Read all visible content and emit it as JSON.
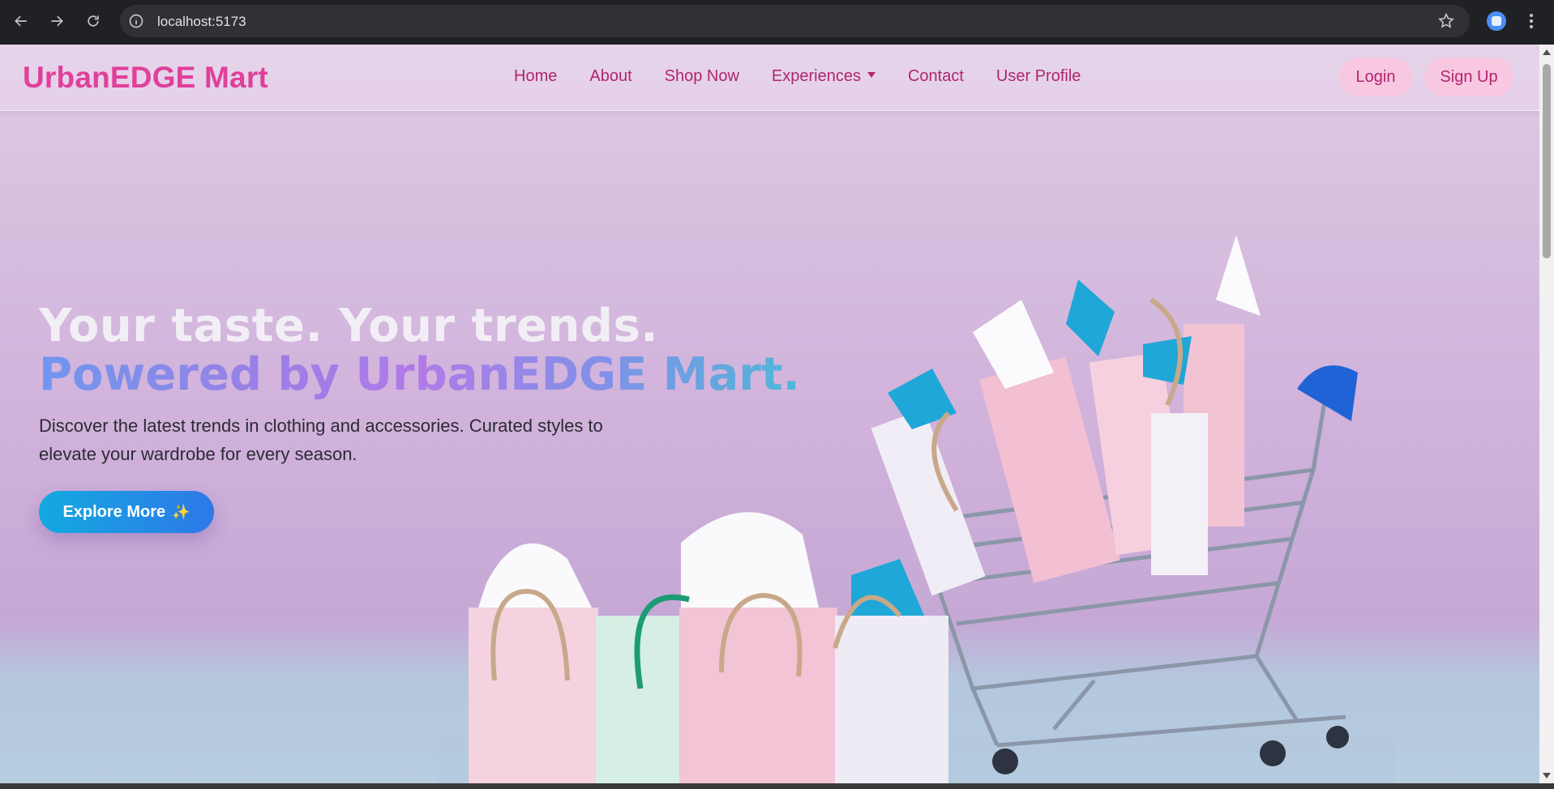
{
  "browser": {
    "url": "localhost:5173",
    "icons": [
      "back-arrow-icon",
      "forward-arrow-icon",
      "reload-icon",
      "site-info-icon",
      "bookmark-star-icon",
      "extension-icon",
      "browser-menu-icon"
    ]
  },
  "navbar": {
    "brand": "UrbanEDGE Mart",
    "links": [
      "Home",
      "About",
      "Shop Now",
      "Experiences",
      "Contact",
      "User Profile"
    ],
    "login": "Login",
    "signup": "Sign Up"
  },
  "hero": {
    "line1": "Your taste. Your trends.",
    "line2": "Powered by UrbanEDGE Mart.",
    "description": "Discover the latest trends in clothing and accessories. Curated styles to elevate your wardrobe for every season.",
    "cta_label": "Explore More",
    "cta_emoji": "✨",
    "image_alt": "shopping-bags-and-cart-illustration"
  },
  "colors": {
    "brand": "#e0409a",
    "nav_text": "#b0256e",
    "auth_bg": "#f8c7e0",
    "cta_start": "#13a9e0",
    "cta_end": "#2f78e8"
  }
}
